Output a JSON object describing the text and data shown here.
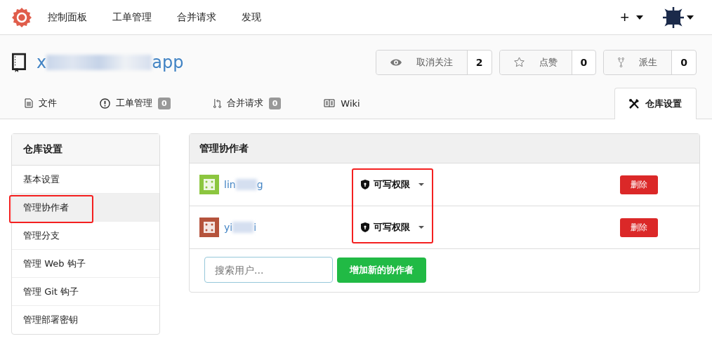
{
  "nav": {
    "items": [
      "控制面板",
      "工单管理",
      "合并请求",
      "发现"
    ],
    "plus": "+"
  },
  "repo": {
    "name_start": "x",
    "name_end": "app",
    "buttons": [
      {
        "kind": "watch",
        "label": "取消关注",
        "count": "2"
      },
      {
        "kind": "star",
        "label": "点赞",
        "count": "0"
      },
      {
        "kind": "fork",
        "label": "派生",
        "count": "0"
      }
    ]
  },
  "tabs": [
    {
      "kind": "files",
      "label": "文件",
      "selected": false
    },
    {
      "kind": "issues",
      "label": "工单管理",
      "count": "0",
      "selected": false
    },
    {
      "kind": "pulls",
      "label": "合并请求",
      "count": "0",
      "selected": false
    },
    {
      "kind": "wiki",
      "label": "Wiki",
      "selected": false
    },
    {
      "kind": "settings",
      "label": "仓库设置",
      "selected": true
    }
  ],
  "sidebar": {
    "title": "仓库设置",
    "items": [
      {
        "label": "基本设置",
        "selected": false,
        "highlighted": false
      },
      {
        "label": "管理协作者",
        "selected": true,
        "highlighted": true
      },
      {
        "label": "管理分支",
        "selected": false,
        "highlighted": false
      },
      {
        "label": "管理 Web 钩子",
        "selected": false,
        "highlighted": false
      },
      {
        "label": "管理 Git 钩子",
        "selected": false,
        "highlighted": false
      },
      {
        "label": "管理部署密钥",
        "selected": false,
        "highlighted": false
      }
    ]
  },
  "panel": {
    "title": "管理协作者",
    "permissions_highlighted": true,
    "collaborators": [
      {
        "name_start": "lin",
        "name_end": "g",
        "color": "#8cc63f",
        "permission": "可写权限",
        "delete": "删除"
      },
      {
        "name_start": "yi",
        "name_end": "i",
        "color": "#b5533c",
        "permission": "可写权限",
        "delete": "删除"
      }
    ],
    "search": {
      "placeholder": "搜索用户..."
    },
    "add_button": "增加新的协作者"
  }
}
